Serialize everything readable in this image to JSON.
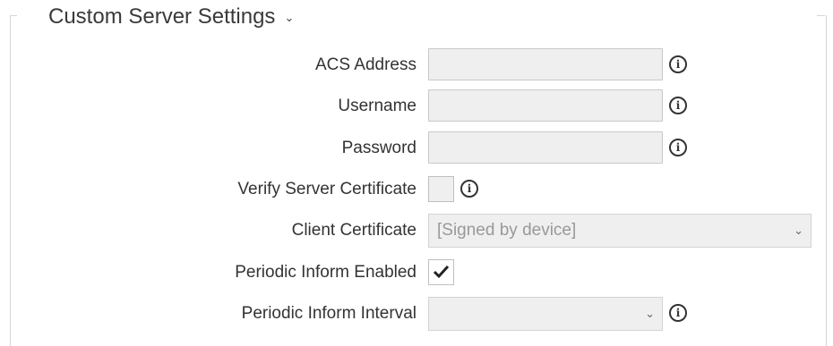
{
  "section": {
    "title": "Custom Server Settings"
  },
  "fields": {
    "acs_address": {
      "label": "ACS Address",
      "value": ""
    },
    "username": {
      "label": "Username",
      "value": ""
    },
    "password": {
      "label": "Password",
      "value": ""
    },
    "verify_cert": {
      "label": "Verify Server Certificate",
      "checked": false
    },
    "client_cert": {
      "label": "Client Certificate",
      "value": "[Signed by device]"
    },
    "periodic_enabled": {
      "label": "Periodic Inform Enabled",
      "checked": true
    },
    "periodic_interval": {
      "label": "Periodic Inform Interval",
      "value": ""
    }
  },
  "icons": {
    "info": "info-icon",
    "chevron": "chevron-down-icon",
    "check": "checkmark-icon"
  }
}
